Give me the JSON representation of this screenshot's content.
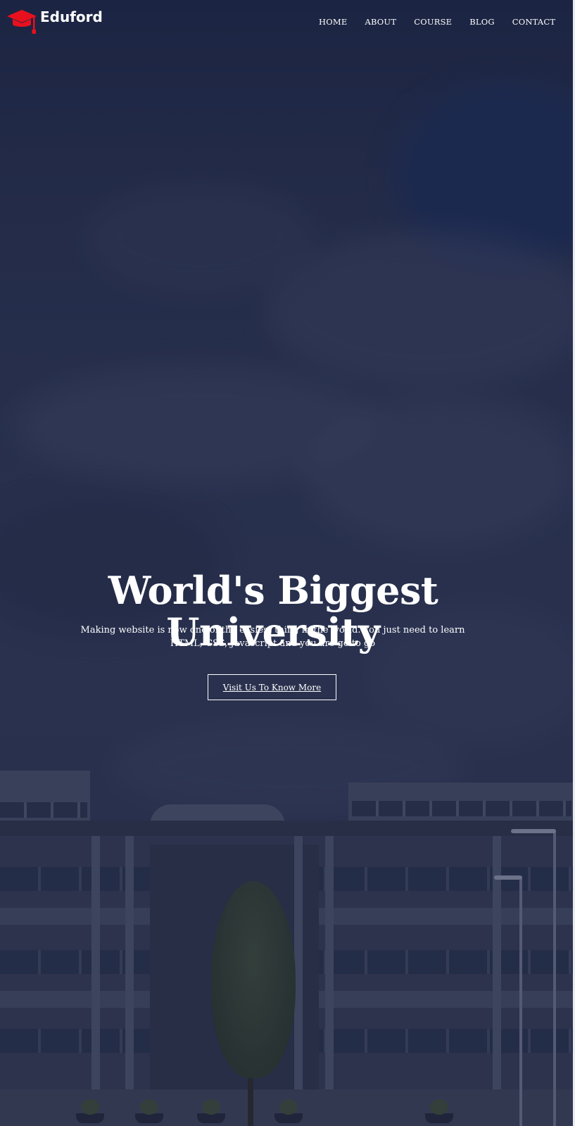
{
  "brand": {
    "name": "Eduford",
    "icon": "graduation-cap-icon",
    "icon_color": "#e8101e"
  },
  "nav": {
    "items": [
      {
        "label": "HOME"
      },
      {
        "label": "ABOUT"
      },
      {
        "label": "COURSE"
      },
      {
        "label": "BLOG"
      },
      {
        "label": "CONTACT"
      }
    ]
  },
  "hero": {
    "title": "World's Biggest University",
    "subtitle": "Making website is now one of the easiest thing in the world. You just need to learn HTML, CSS, Javascript and you are go to go",
    "button_label": "Visit Us To Know More"
  },
  "colors": {
    "overlay": "#1c2442",
    "text": "#ffffff",
    "accent": "#e8101e"
  }
}
